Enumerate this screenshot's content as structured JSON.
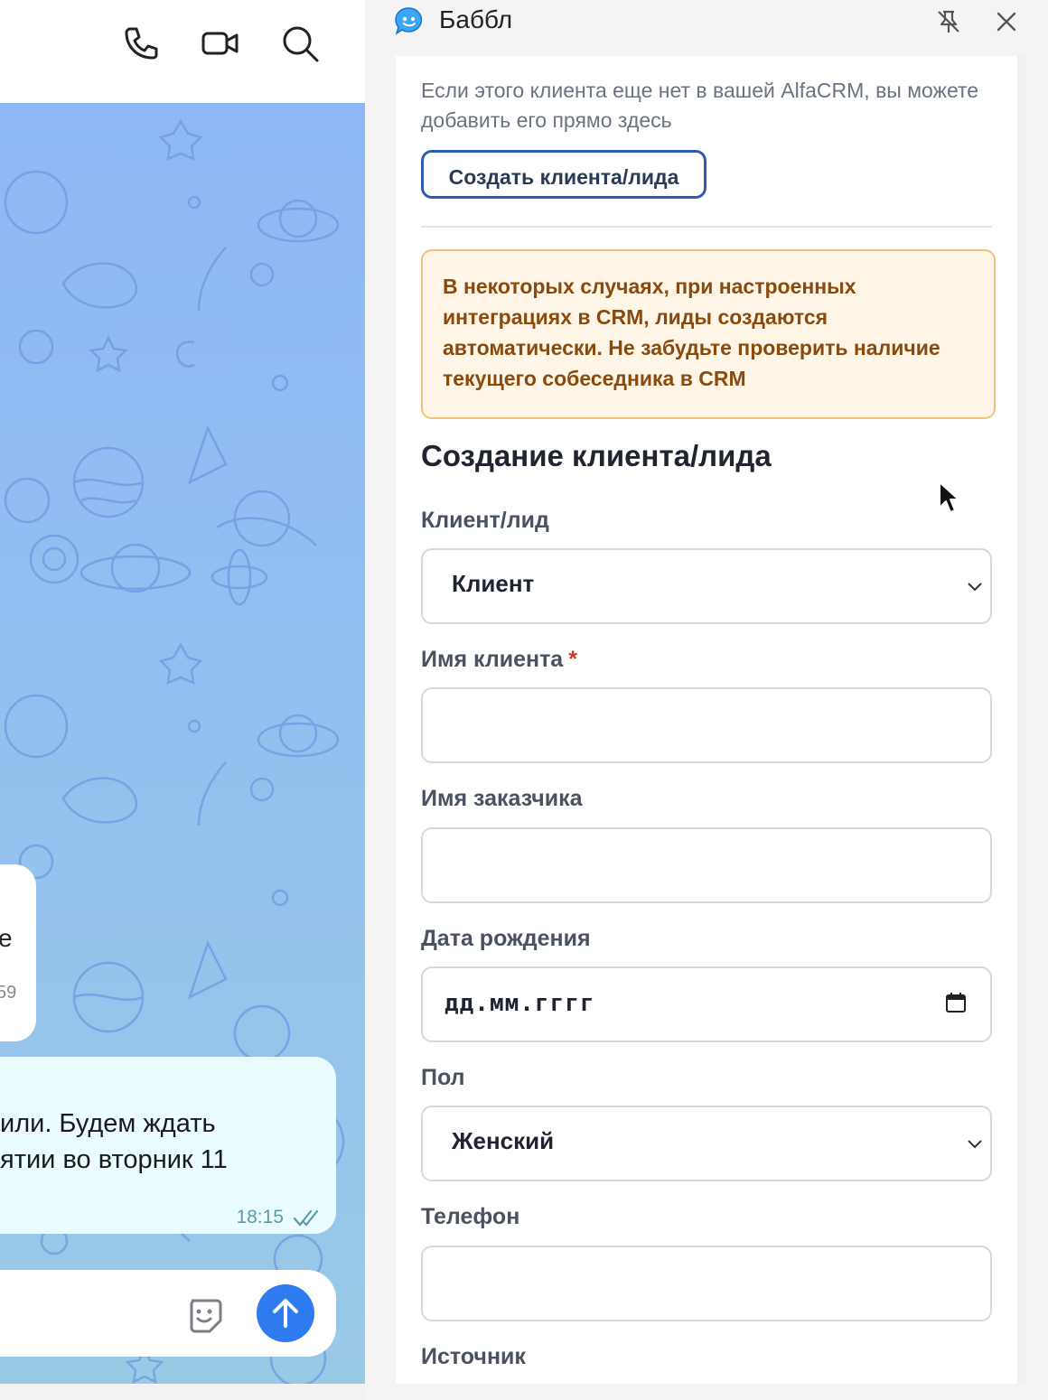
{
  "chat": {
    "header_icons": [
      "phone-icon",
      "video-icon",
      "search-icon"
    ],
    "bubble1": {
      "text_fragment": "е",
      "time_fragment": "59"
    },
    "bubble2": {
      "line1": "или. Будем ждать",
      "line2": "ятии во вторник 11",
      "time": "18:15"
    },
    "composer_icons": [
      "sticker-icon",
      "send-arrow-icon"
    ]
  },
  "panel": {
    "title": "Баббл",
    "intro_text": "Если этого клиента еще нет в вашей AlfaCRM, вы можете добавить его прямо здесь",
    "create_button": "Создать клиента/лида",
    "warning": "В некоторых случаях, при настроенных интеграциях в CRM, лиды создаются автоматически. Не забудьте проверить наличие текущего собеседника в CRM",
    "form": {
      "title": "Создание клиента/лида",
      "type_label": "Клиент/лид",
      "type_value": "Клиент",
      "client_name_label": "Имя клиента",
      "required_mark": "*",
      "client_name_value": "",
      "customer_name_label": "Имя заказчика",
      "customer_name_value": "",
      "birthdate_label": "Дата рождения",
      "birthdate_placeholder": "дд.мм.гггг",
      "gender_label": "Пол",
      "gender_value": "Женский",
      "phone_label": "Телефон",
      "phone_value": "",
      "source_label": "Источник"
    }
  },
  "colors": {
    "accent_blue": "#2f7bf0",
    "button_border": "#2d5bb4",
    "warning_bg": "#fff6e8",
    "warning_border": "#f0c27a",
    "warning_text": "#8a4a0c",
    "required": "#c43b2b"
  }
}
